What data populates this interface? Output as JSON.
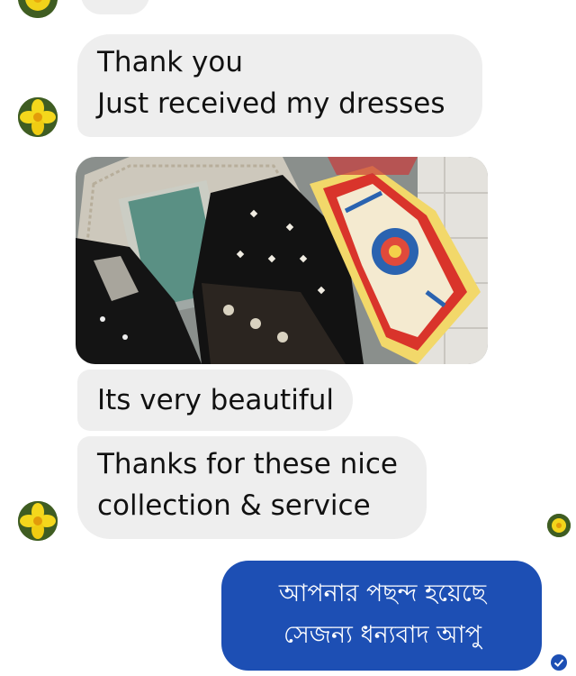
{
  "messages": [
    {
      "lines": [
        "Thank you",
        "Just received my dresses"
      ]
    },
    {
      "photo": "photo-of-dresses"
    },
    {
      "lines": [
        "Its very beautiful"
      ]
    },
    {
      "lines": [
        "Thanks for these nice",
        "collection & service"
      ]
    }
  ],
  "reply": {
    "lines": [
      "আপনার পছন্দ হয়েছে",
      "সেজন্য ধন্যবাদ আপু"
    ]
  },
  "colors": {
    "incoming_bubble": "#eeeeee",
    "outgoing_bubble": "#1d4fb4",
    "background": "#ffffff"
  },
  "icons": {
    "contact_avatar": "yellow-flower-avatar",
    "seen_indicator": "yellow-flower-avatar",
    "delivered_indicator": "check-circle-icon"
  }
}
